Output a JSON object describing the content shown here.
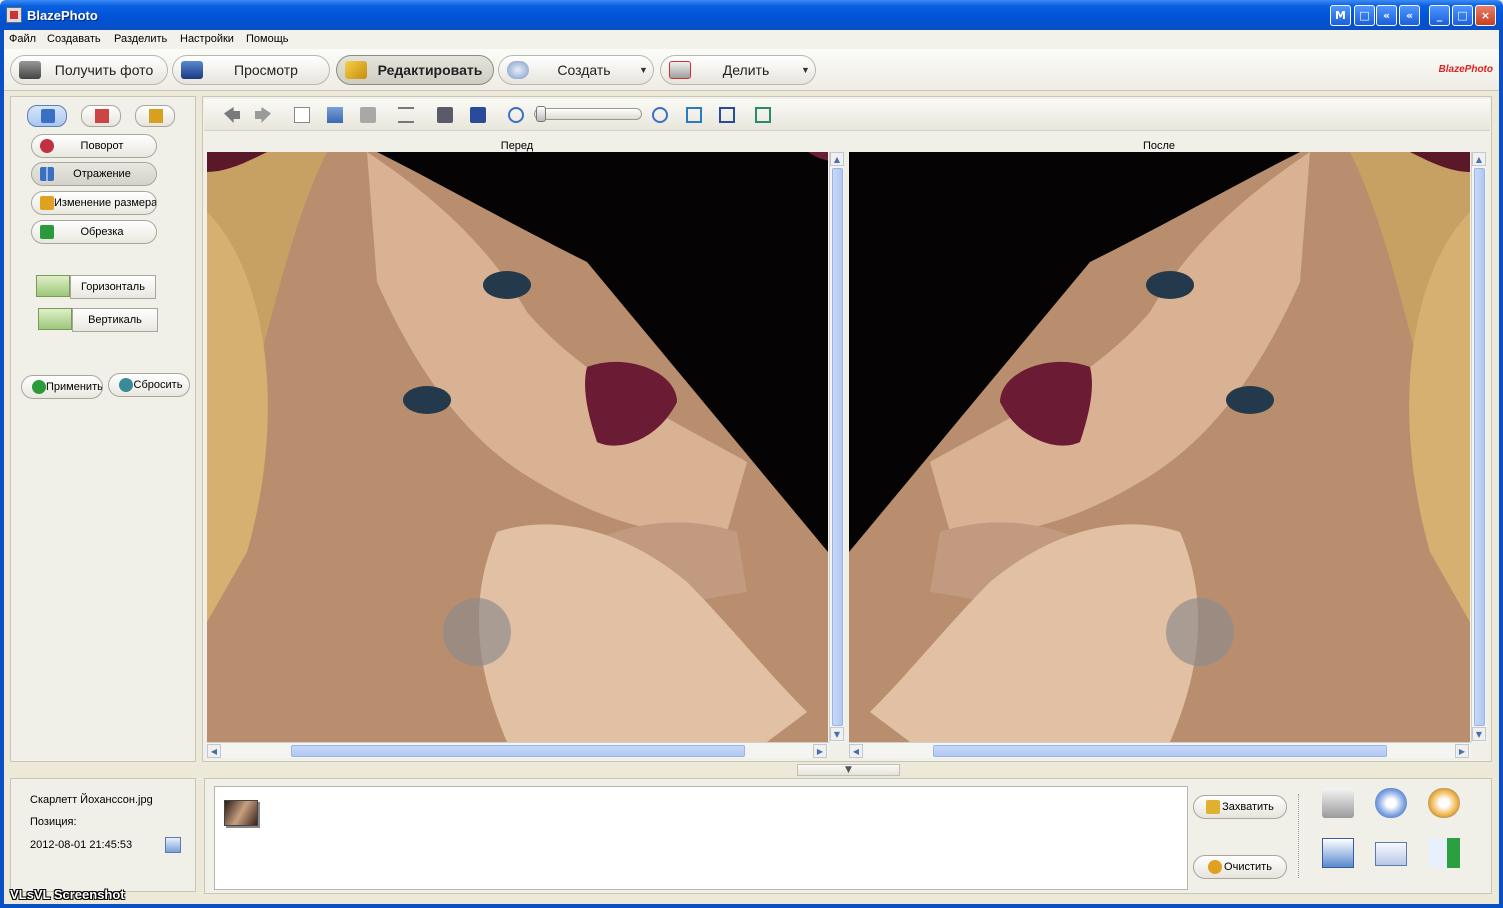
{
  "window": {
    "title": "BlazePhoto",
    "buttons": [
      "M",
      "□",
      "«",
      "_",
      "□",
      "×"
    ]
  },
  "menu": {
    "items": [
      "Файл",
      "Создавать",
      "Разделить",
      "Настройки",
      "Помощь"
    ]
  },
  "toolbar": {
    "get_photo": "Получить фото",
    "view": "Просмотр",
    "edit": "Редактировать",
    "create": "Создать",
    "share": "Делить",
    "brand": "BlazePhoto"
  },
  "tools": {
    "rotate": "Поворот",
    "flip": "Отражение",
    "resize": "Изменение размера",
    "crop": "Обрезка",
    "horizontal": "Горизонталь",
    "vertical": "Вертикаль",
    "apply": "Применить",
    "reset": "Сбросить"
  },
  "preview": {
    "before": "Перед",
    "after": "После"
  },
  "info": {
    "filename": "Скарлетт Йоханссон.jpg",
    "position_label": "Позиция:",
    "datetime": "2012-08-01 21:45:53"
  },
  "tray": {
    "capture": "Захватить",
    "clear": "Очистить"
  },
  "icons": [
    "print-icon",
    "cd-icon",
    "dvd-icon",
    "web-edit-icon",
    "email-icon",
    "export-icon"
  ],
  "colors": {
    "titlebar": "#0052d6",
    "scroll_thumb": "#b0c8f4",
    "brand": "#d22222"
  },
  "watermark": "VLsVL Screenshot"
}
